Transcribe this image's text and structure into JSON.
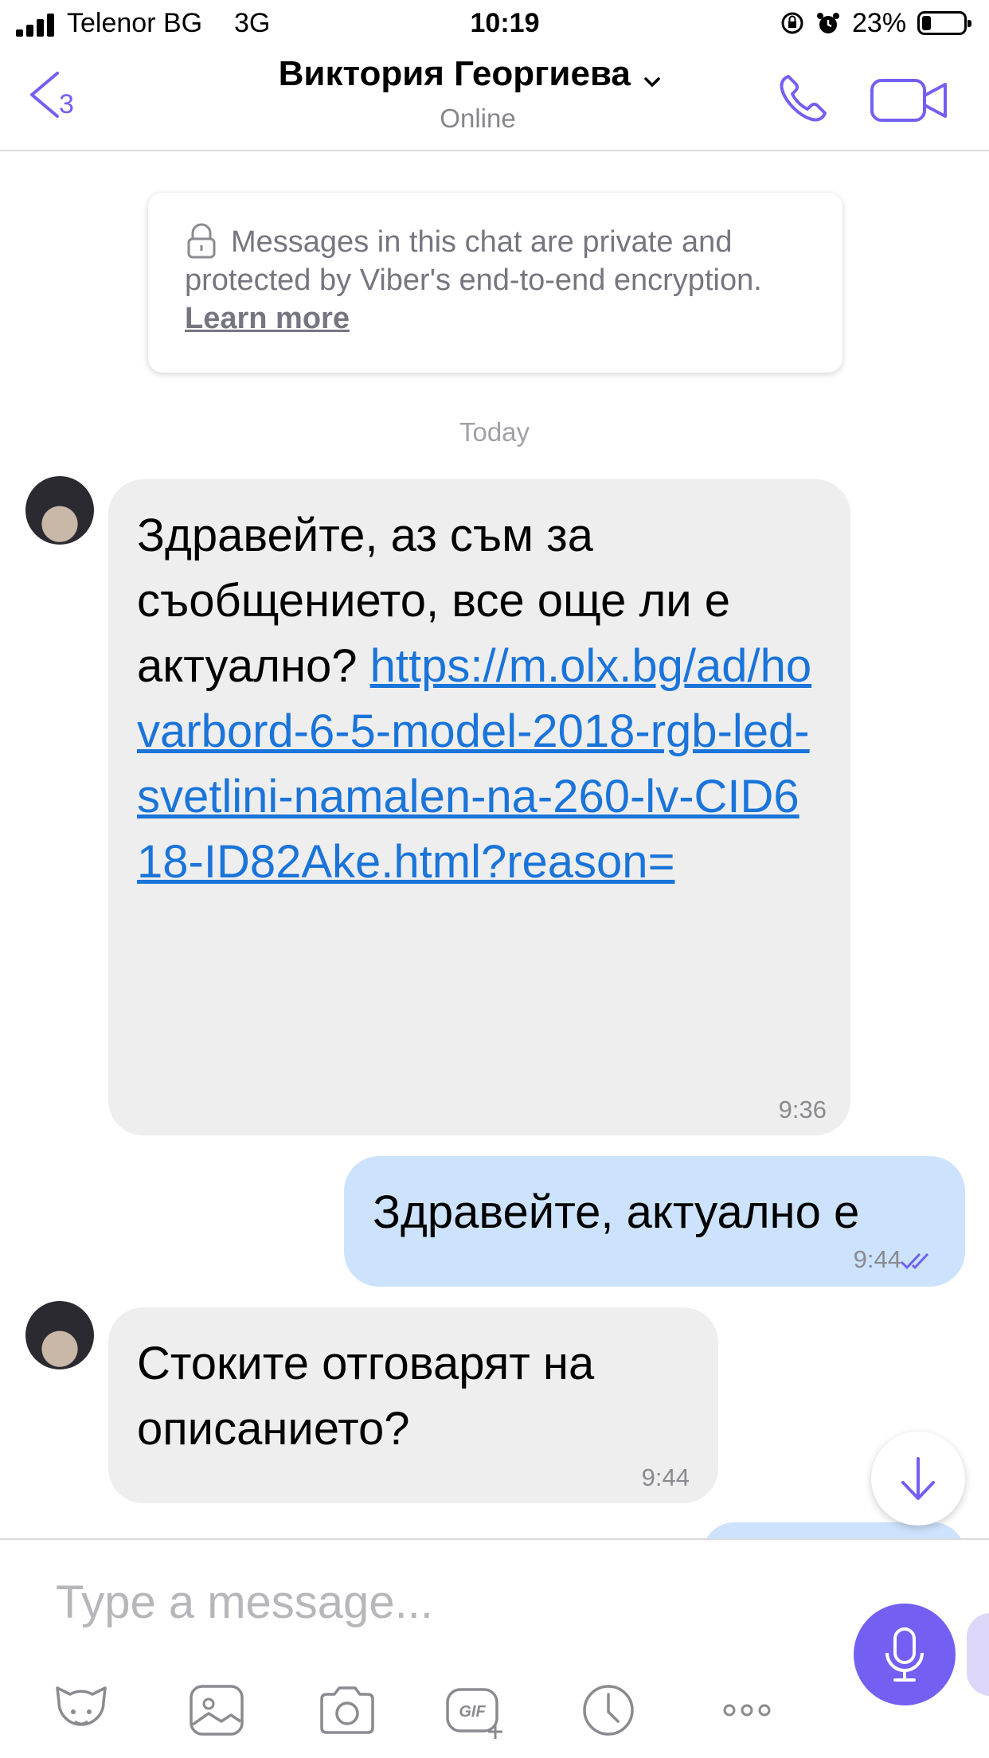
{
  "status_bar": {
    "carrier": "Telenor BG",
    "network": "3G",
    "time": "10:19",
    "battery_percent": "23%",
    "battery_level": 0.23
  },
  "header": {
    "back_count": "3",
    "title": "Виктория Георгиева",
    "subtitle": "Online"
  },
  "notice": {
    "text": "Messages in this chat are private and protected by Viber's end-to-end encryption.",
    "link": "Learn more"
  },
  "date_separator": "Today",
  "messages": [
    {
      "direction": "incoming",
      "text": "Здравейте, аз съм за съобщението, все още ли е актуално?",
      "link": "https://m.olx.bg/ad/hovarbord-6-5-model-2018-rgb-led-svetlini-namalen-na-260-lv-CID618-ID82Ake.html?reason=",
      "time": "9:36"
    },
    {
      "direction": "outgoing",
      "text": "Здравейте, актуално е",
      "time": "9:44",
      "status": "read"
    },
    {
      "direction": "incoming",
      "text": "Стоките отговарят на описанието?",
      "time": "9:44"
    }
  ],
  "composer": {
    "placeholder": "Type a message...",
    "toolbar": [
      "sticker-icon",
      "gallery-icon",
      "camera-icon",
      "gif-icon",
      "timer-icon",
      "more-icon"
    ]
  },
  "colors": {
    "accent": "#7360f2",
    "incoming_bubble": "#eeeeef",
    "outgoing_bubble": "#cde3fd",
    "link": "#1a74d9"
  }
}
